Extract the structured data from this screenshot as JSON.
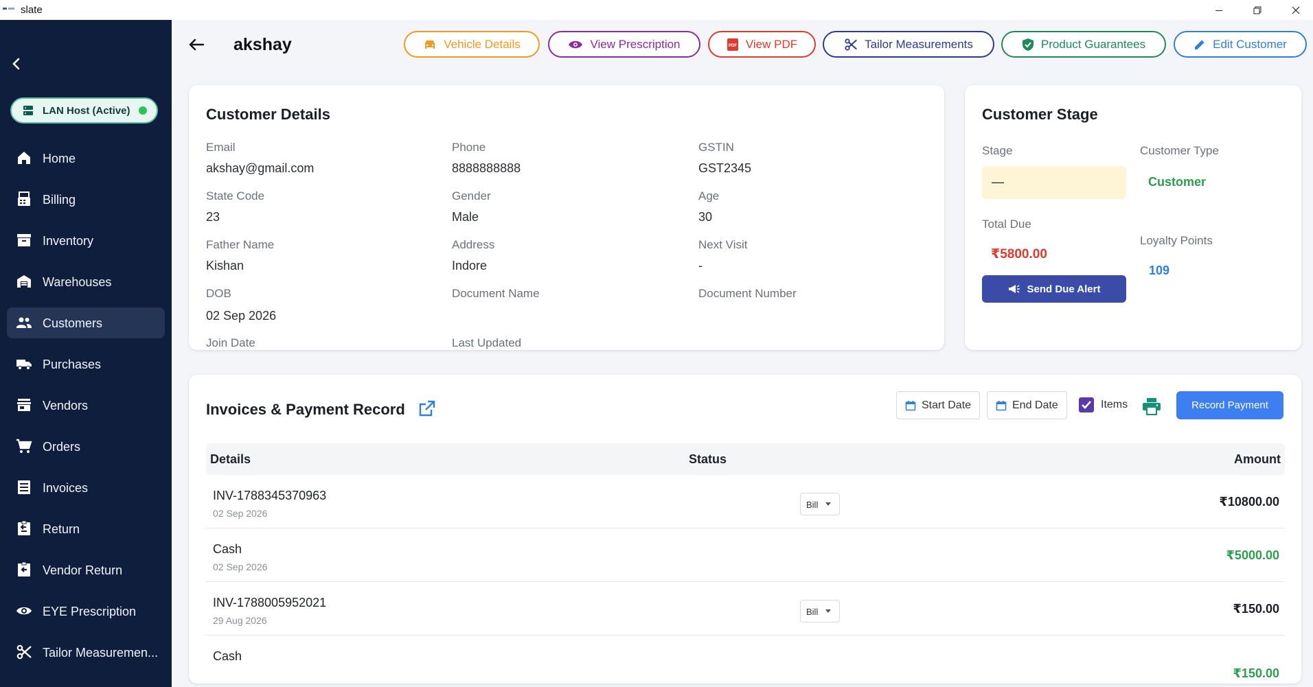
{
  "window": {
    "title": "slate"
  },
  "sidebar": {
    "lan_status": "LAN Host (Active)",
    "items": [
      {
        "label": "Home",
        "icon": "home-icon"
      },
      {
        "label": "Billing",
        "icon": "billing-icon"
      },
      {
        "label": "Inventory",
        "icon": "inventory-icon"
      },
      {
        "label": "Warehouses",
        "icon": "warehouse-icon"
      },
      {
        "label": "Customers",
        "icon": "customers-icon"
      },
      {
        "label": "Purchases",
        "icon": "truck-icon"
      },
      {
        "label": "Vendors",
        "icon": "store-icon"
      },
      {
        "label": "Orders",
        "icon": "cart-icon"
      },
      {
        "label": "Invoices",
        "icon": "invoice-icon"
      },
      {
        "label": "Return",
        "icon": "return-icon"
      },
      {
        "label": "Vendor Return",
        "icon": "vendor-return-icon"
      },
      {
        "label": "EYE Prescription",
        "icon": "eye-icon"
      },
      {
        "label": "Tailor Measuremen...",
        "icon": "scissors-icon"
      }
    ],
    "active_index": 4
  },
  "header": {
    "customer_name": "akshay",
    "buttons": {
      "vehicle": "Vehicle Details",
      "prescription": "View Prescription",
      "pdf": "View PDF",
      "tailor": "Tailor Measurements",
      "guarantees": "Product Guarantees",
      "edit": "Edit Customer"
    },
    "colors": {
      "vehicle": "#f39a1e",
      "prescription": "#8e2a9c",
      "pdf": "#e03a2f",
      "tailor": "#2e3a8c",
      "guarantees": "#1e8a5c",
      "edit": "#2f7fd8"
    }
  },
  "customer_details": {
    "title": "Customer Details",
    "email_label": "Email",
    "email": "akshay@gmail.com",
    "phone_label": "Phone",
    "phone": "8888888888",
    "gstin_label": "GSTIN",
    "gstin": "GST2345",
    "state_code_label": "State Code",
    "state_code": "23",
    "gender_label": "Gender",
    "gender": "Male",
    "age_label": "Age",
    "age": "30",
    "father_name_label": "Father Name",
    "father_name": "Kishan",
    "address_label": "Address",
    "address": "Indore",
    "next_visit_label": "Next Visit",
    "next_visit": "-",
    "dob_label": "DOB",
    "dob": "02 Sep 2026",
    "document_name_label": "Document Name",
    "document_number_label": "Document Number",
    "join_date_label": "Join Date",
    "last_updated_label": "Last Updated"
  },
  "customer_stage": {
    "title": "Customer Stage",
    "stage_label": "Stage",
    "stage_value": "—",
    "type_label": "Customer Type",
    "type_value": "Customer",
    "due_label": "Total Due",
    "due_value": "₹5800.00",
    "loyalty_label": "Loyalty Points",
    "loyalty_value": "109",
    "send_alert": "Send Due Alert",
    "colors": {
      "type": "#2e9d4f",
      "due": "#e03a2f",
      "loyalty": "#2f7fd8"
    }
  },
  "invoices": {
    "title": "Invoices & Payment Record",
    "start_date": "Start Date",
    "end_date": "End Date",
    "items_label": "Items",
    "items_checked": true,
    "record_payment": "Record Payment",
    "columns": {
      "details": "Details",
      "status": "Status",
      "amount": "Amount"
    },
    "rows": [
      {
        "title": "INV-1788345370963",
        "date": "02 Sep 2026",
        "status": "Bill",
        "amount": "₹10800.00"
      },
      {
        "title": "Cash",
        "date": "02 Sep 2026",
        "amount": "₹5000.00"
      },
      {
        "title": "INV-1788005952021",
        "date": "29 Aug 2026",
        "status": "Bill",
        "amount": "₹150.00"
      },
      {
        "title": "Cash",
        "amount": "₹150.00"
      }
    ],
    "colors": {
      "bill_amount": "#1b1f24",
      "cash_amount": "#2e9d4f"
    }
  }
}
